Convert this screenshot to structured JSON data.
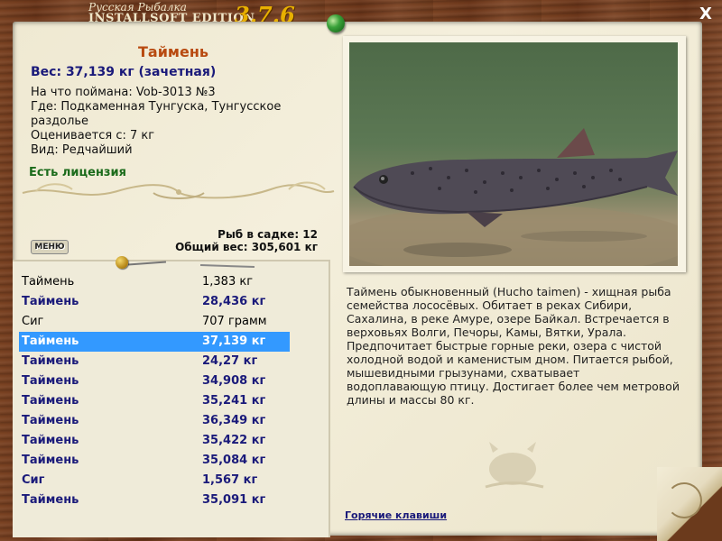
{
  "app": {
    "title_line1": "Русская Рыбалка",
    "title_line2": "INSTALLSOFT EDITION",
    "version": "3.7.6",
    "close_label": "X"
  },
  "catch": {
    "name": "Таймень",
    "weight_line": "Вес: 37,139 кг (зачетная)",
    "bait_line": "На что поймана: Vob-3013 №3",
    "location_line": "Где: Подкаменная Тунгуска, Тунгусское раздолье",
    "value_line": "Оценивается с: 7 кг",
    "kind_line": "Вид: Редчайший",
    "license": "Есть лицензия"
  },
  "stats": {
    "count_line": "Рыб в садке: 12",
    "total_line": "Общий вес: 305,601 кг"
  },
  "menu": {
    "label": "МЕНЮ"
  },
  "fish_list": [
    {
      "name": "Таймень",
      "weight": "1,383 кг",
      "style": "plain"
    },
    {
      "name": "Таймень",
      "weight": "28,436 кг",
      "style": "bold"
    },
    {
      "name": "Сиг",
      "weight": "707 грамм",
      "style": "plain"
    },
    {
      "name": "Таймень",
      "weight": "37,139 кг",
      "style": "selected"
    },
    {
      "name": "Таймень",
      "weight": "24,27 кг",
      "style": "bold"
    },
    {
      "name": "Таймень",
      "weight": "34,908 кг",
      "style": "bold"
    },
    {
      "name": "Таймень",
      "weight": "35,241 кг",
      "style": "bold"
    },
    {
      "name": "Таймень",
      "weight": "36,349 кг",
      "style": "bold"
    },
    {
      "name": "Таймень",
      "weight": "35,422 кг",
      "style": "bold"
    },
    {
      "name": "Таймень",
      "weight": "35,084 кг",
      "style": "bold"
    },
    {
      "name": "Сиг",
      "weight": "1,567 кг",
      "style": "bold"
    },
    {
      "name": "Таймень",
      "weight": "35,091 кг",
      "style": "bold"
    }
  ],
  "description": "Таймень обыкновенный (Hucho taimen) - хищная рыба семейства лососёвых. Обитает в реках Сибири, Сахалина, в реке Амуре, озере Байкал. Встречается в верховьях Волги, Печоры, Камы, Вятки, Урала. Предпочитает быстрые горные реки, озера с чистой холодной водой и каменистым дном. Питается рыбой, мышевидными грызунами, схватывает водоплавающую птицу. Достигает более чем метровой длины и массы 80 кг.",
  "hotkeys_label": "Горячие клавиши",
  "colors": {
    "wood": "#6b3a1c",
    "paper": "#efe9d2",
    "fish_name": "#b84a10",
    "bold_text": "#1a1a7a",
    "license": "#1b6b1b",
    "selection": "#3399ff"
  }
}
